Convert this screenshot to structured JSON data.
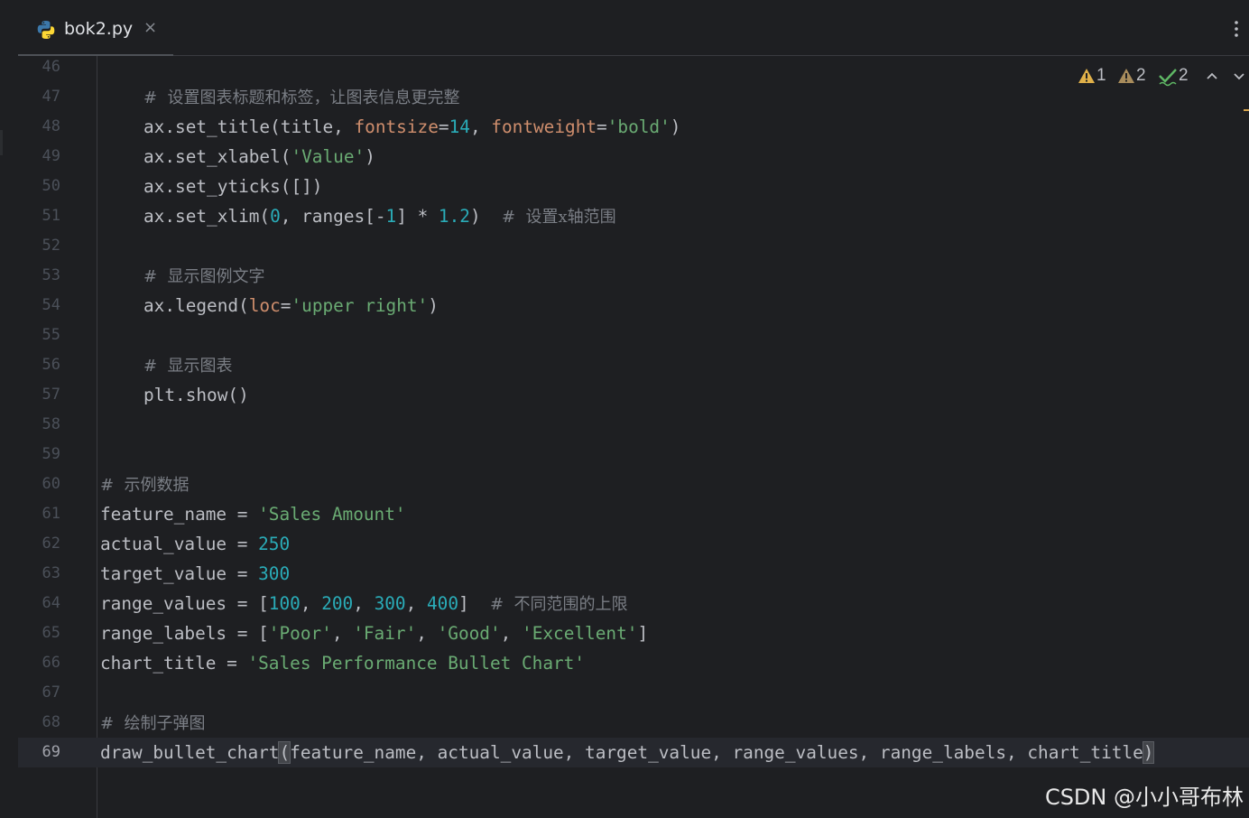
{
  "tab": {
    "filename": "bok2.py",
    "close_glyph": "×",
    "icon": "python-icon"
  },
  "toolbar": {
    "more_icon": "vertical-ellipsis-icon"
  },
  "inspections": {
    "errors": "1",
    "warnings": "2",
    "weak_warnings": "2",
    "icons": [
      "error-triangle-icon",
      "warning-triangle-icon",
      "check-typo-icon",
      "chevron-up-icon",
      "chevron-down-icon"
    ],
    "colors": {
      "error": "#e0b049",
      "warning": "#a88c5c",
      "typo": "#5fb865"
    }
  },
  "code_lines": [
    {
      "n": "46",
      "indent": 0,
      "tokens": []
    },
    {
      "n": "47",
      "indent": 1,
      "tokens": [
        {
          "t": "cm",
          "v": "#  设置图表标题和标签，让图表信息更完整"
        }
      ]
    },
    {
      "n": "48",
      "indent": 1,
      "tokens": [
        {
          "t": "p",
          "v": "ax.set_title(title, "
        },
        {
          "t": "kw",
          "v": "fontsize"
        },
        {
          "t": "p",
          "v": "="
        },
        {
          "t": "num",
          "v": "14"
        },
        {
          "t": "p",
          "v": ", "
        },
        {
          "t": "kw",
          "v": "fontweight"
        },
        {
          "t": "p",
          "v": "="
        },
        {
          "t": "str",
          "v": "'bold'"
        },
        {
          "t": "p",
          "v": ")"
        }
      ]
    },
    {
      "n": "49",
      "indent": 1,
      "tokens": [
        {
          "t": "p",
          "v": "ax.set_xlabel("
        },
        {
          "t": "str",
          "v": "'Value'"
        },
        {
          "t": "p",
          "v": ")"
        }
      ]
    },
    {
      "n": "50",
      "indent": 1,
      "tokens": [
        {
          "t": "p",
          "v": "ax.set_yticks([])"
        }
      ]
    },
    {
      "n": "51",
      "indent": 1,
      "tokens": [
        {
          "t": "p",
          "v": "ax.set_xlim("
        },
        {
          "t": "num",
          "v": "0"
        },
        {
          "t": "p",
          "v": ", ranges[-"
        },
        {
          "t": "num",
          "v": "1"
        },
        {
          "t": "p",
          "v": "] * "
        },
        {
          "t": "num",
          "v": "1.2"
        },
        {
          "t": "p",
          "v": ")  "
        },
        {
          "t": "cm",
          "v": "#  设置x轴范围"
        }
      ]
    },
    {
      "n": "52",
      "indent": 0,
      "tokens": []
    },
    {
      "n": "53",
      "indent": 1,
      "tokens": [
        {
          "t": "cm",
          "v": "#  显示图例文字"
        }
      ]
    },
    {
      "n": "54",
      "indent": 1,
      "tokens": [
        {
          "t": "p",
          "v": "ax.legend("
        },
        {
          "t": "kw",
          "v": "loc"
        },
        {
          "t": "p",
          "v": "="
        },
        {
          "t": "str",
          "v": "'upper right'"
        },
        {
          "t": "p",
          "v": ")"
        }
      ]
    },
    {
      "n": "55",
      "indent": 0,
      "tokens": []
    },
    {
      "n": "56",
      "indent": 1,
      "tokens": [
        {
          "t": "cm",
          "v": "#  显示图表"
        }
      ]
    },
    {
      "n": "57",
      "indent": 1,
      "tokens": [
        {
          "t": "p",
          "v": "plt.show()"
        }
      ]
    },
    {
      "n": "58",
      "indent": 0,
      "tokens": []
    },
    {
      "n": "59",
      "indent": 0,
      "tokens": []
    },
    {
      "n": "60",
      "indent": 0,
      "tokens": [
        {
          "t": "cm",
          "v": "#  示例数据"
        }
      ]
    },
    {
      "n": "61",
      "indent": 0,
      "tokens": [
        {
          "t": "p",
          "v": "feature_name = "
        },
        {
          "t": "str",
          "v": "'Sales Amount'"
        }
      ]
    },
    {
      "n": "62",
      "indent": 0,
      "tokens": [
        {
          "t": "p",
          "v": "actual_value = "
        },
        {
          "t": "num",
          "v": "250"
        }
      ]
    },
    {
      "n": "63",
      "indent": 0,
      "tokens": [
        {
          "t": "p",
          "v": "target_value = "
        },
        {
          "t": "num",
          "v": "300"
        }
      ]
    },
    {
      "n": "64",
      "indent": 0,
      "tokens": [
        {
          "t": "p",
          "v": "range_values = ["
        },
        {
          "t": "num",
          "v": "100"
        },
        {
          "t": "p",
          "v": ", "
        },
        {
          "t": "num",
          "v": "200"
        },
        {
          "t": "p",
          "v": ", "
        },
        {
          "t": "num",
          "v": "300"
        },
        {
          "t": "p",
          "v": ", "
        },
        {
          "t": "num",
          "v": "400"
        },
        {
          "t": "p",
          "v": "]  "
        },
        {
          "t": "cm",
          "v": "#  不同范围的上限"
        }
      ]
    },
    {
      "n": "65",
      "indent": 0,
      "tokens": [
        {
          "t": "p",
          "v": "range_labels = ["
        },
        {
          "t": "str",
          "v": "'Poor'"
        },
        {
          "t": "p",
          "v": ", "
        },
        {
          "t": "str",
          "v": "'Fair'"
        },
        {
          "t": "p",
          "v": ", "
        },
        {
          "t": "str",
          "v": "'Good'"
        },
        {
          "t": "p",
          "v": ", "
        },
        {
          "t": "str",
          "v": "'Excellent'"
        },
        {
          "t": "p",
          "v": "]"
        }
      ]
    },
    {
      "n": "66",
      "indent": 0,
      "tokens": [
        {
          "t": "p",
          "v": "chart_title = "
        },
        {
          "t": "str",
          "v": "'Sales Performance Bullet Chart'"
        }
      ]
    },
    {
      "n": "67",
      "indent": 0,
      "tokens": []
    },
    {
      "n": "68",
      "indent": 0,
      "tokens": [
        {
          "t": "cm",
          "v": "#  绘制子弹图"
        }
      ]
    },
    {
      "n": "69",
      "indent": 0,
      "current": true,
      "tokens": [
        {
          "t": "p",
          "v": "draw_bullet_chart"
        },
        {
          "t": "brace",
          "v": "("
        },
        {
          "t": "p",
          "v": "feature_name, actual_value, target_value, range_values, range_labels, chart_title"
        },
        {
          "t": "brace",
          "v": ")"
        }
      ]
    }
  ],
  "watermark": "CSDN @小小哥布林"
}
